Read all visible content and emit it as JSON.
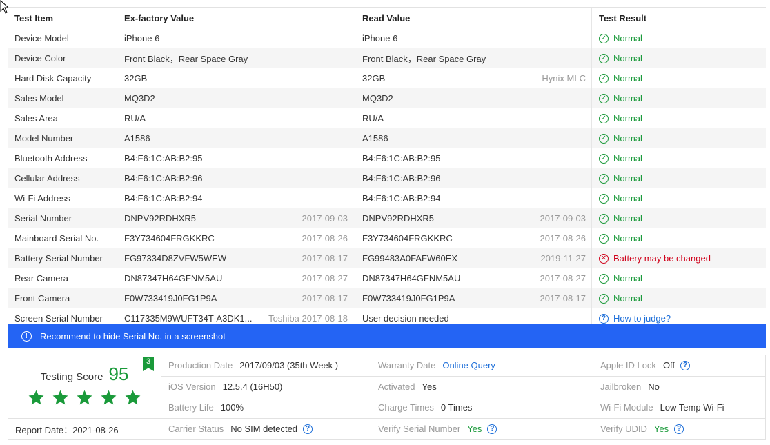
{
  "headers": {
    "test_item": "Test Item",
    "ex_factory": "Ex-factory Value",
    "read_value": "Read Value",
    "test_result": "Test Result"
  },
  "rows": [
    {
      "item": "Device Model",
      "ex_value": "iPhone 6",
      "ex_meta": "",
      "read_value": "iPhone 6",
      "read_meta": "",
      "result": "Normal"
    },
    {
      "item": "Device Color",
      "ex_value": "Front Black，Rear Space Gray",
      "ex_meta": "",
      "read_value": "Front Black，Rear Space Gray",
      "read_meta": "",
      "result": "Normal"
    },
    {
      "item": "Hard Disk Capacity",
      "ex_value": "32GB",
      "ex_meta": "",
      "read_value": "32GB",
      "read_meta": "Hynix MLC",
      "result": "Normal"
    },
    {
      "item": "Sales Model",
      "ex_value": "MQ3D2",
      "ex_meta": "",
      "read_value": "MQ3D2",
      "read_meta": "",
      "result": "Normal"
    },
    {
      "item": "Sales Area",
      "ex_value": "RU/A",
      "ex_meta": "",
      "read_value": "RU/A",
      "read_meta": "",
      "result": "Normal"
    },
    {
      "item": "Model Number",
      "ex_value": "A1586",
      "ex_meta": "",
      "read_value": "A1586",
      "read_meta": "",
      "result": "Normal"
    },
    {
      "item": "Bluetooth Address",
      "ex_value": "B4:F6:1C:AB:B2:95",
      "ex_meta": "",
      "read_value": "B4:F6:1C:AB:B2:95",
      "read_meta": "",
      "result": "Normal"
    },
    {
      "item": "Cellular Address",
      "ex_value": "B4:F6:1C:AB:B2:96",
      "ex_meta": "",
      "read_value": "B4:F6:1C:AB:B2:96",
      "read_meta": "",
      "result": "Normal"
    },
    {
      "item": "Wi-Fi Address",
      "ex_value": "B4:F6:1C:AB:B2:94",
      "ex_meta": "",
      "read_value": "B4:F6:1C:AB:B2:94",
      "read_meta": "",
      "result": "Normal"
    },
    {
      "item": "Serial Number",
      "ex_value": "DNPV92RDHXR5",
      "ex_meta": "2017-09-03",
      "read_value": "DNPV92RDHXR5",
      "read_meta": "2017-09-03",
      "result": "Normal"
    },
    {
      "item": "Mainboard Serial No.",
      "ex_value": "F3Y734604FRGKKRC",
      "ex_meta": "2017-08-26",
      "read_value": "F3Y734604FRGKKRC",
      "read_meta": "2017-08-26",
      "result": "Normal"
    },
    {
      "item": "Battery Serial Number",
      "ex_value": "FG97334D8ZVFW5WEW",
      "ex_meta": "2017-08-17",
      "read_value": "FG99483A0FAFW60EX",
      "read_meta": "2019-11-27",
      "result": "Battery may be changed"
    },
    {
      "item": "Rear Camera",
      "ex_value": "DN87347H64GFNM5AU",
      "ex_meta": "2017-08-27",
      "read_value": "DN87347H64GFNM5AU",
      "read_meta": "2017-08-27",
      "result": "Normal"
    },
    {
      "item": "Front Camera",
      "ex_value": "F0W733419J0FG1P9A",
      "ex_meta": "2017-08-17",
      "read_value": "F0W733419J0FG1P9A",
      "read_meta": "2017-08-17",
      "result": "Normal"
    },
    {
      "item": "Screen Serial Number",
      "ex_value": "C117335M9WUFT34T-A3DK1...",
      "ex_meta": "Toshiba 2017-08-18",
      "read_value": "User decision needed",
      "read_meta": "",
      "result": "How to judge?"
    }
  ],
  "banner": {
    "text": "Recommend to hide Serial No. in a screenshot"
  },
  "score": {
    "label": "Testing Score",
    "value": "95",
    "badge": "3",
    "stars": 5,
    "report_date": "Report Date：2021-08-26"
  },
  "summary": {
    "production_date_label": "Production Date",
    "production_date_value": "2017/09/03 (35th Week )",
    "warranty_label": "Warranty Date",
    "warranty_value": "Online Query",
    "apple_id_label": "Apple ID Lock",
    "apple_id_value": "Off",
    "ios_label": "iOS Version",
    "ios_value": "12.5.4 (16H50)",
    "activated_label": "Activated",
    "activated_value": "Yes",
    "jailbroken_label": "Jailbroken",
    "jailbroken_value": "No",
    "battery_label": "Battery Life",
    "battery_value": "100%",
    "charge_label": "Charge Times",
    "charge_value": "0 Times",
    "wifi_label": "Wi-Fi Module",
    "wifi_value": "Low Temp Wi-Fi",
    "carrier_label": "Carrier Status",
    "carrier_value": "No SIM detected",
    "verify_serial_label": "Verify Serial Number",
    "verify_serial_value": "Yes",
    "verify_udid_label": "Verify UDID",
    "verify_udid_value": "Yes"
  },
  "colors": {
    "ok": "#1a9a3a",
    "bad": "#d0021b",
    "link": "#1e6fd9",
    "banner": "#2464f4"
  },
  "icons": {
    "ok": "check-circle-icon",
    "bad": "x-circle-icon",
    "help": "question-circle-icon",
    "info": "info-circle-icon",
    "star": "star-icon"
  }
}
